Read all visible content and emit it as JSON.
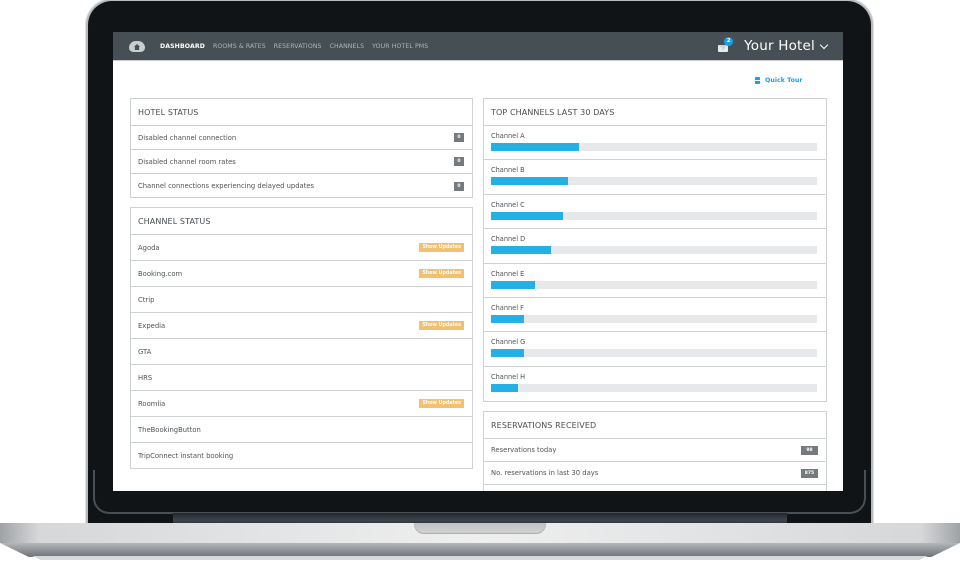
{
  "nav": {
    "items": [
      {
        "label": "DASHBOARD",
        "active": true
      },
      {
        "label": "ROOMS & RATES",
        "active": false
      },
      {
        "label": "RESERVATIONS",
        "active": false
      },
      {
        "label": "CHANNELS",
        "active": false
      },
      {
        "label": "YOUR HOTEL PMS",
        "active": false
      }
    ],
    "mail_count": "2",
    "hotel_name": "Your Hotel"
  },
  "quick_tour": {
    "label": "Quick Tour"
  },
  "hotel_status": {
    "title": "HOTEL STATUS",
    "rows": [
      {
        "label": "Disabled channel connection",
        "count": "0"
      },
      {
        "label": "Disabled channel room rates",
        "count": "0"
      },
      {
        "label": "Channel connections experiencing delayed updates",
        "count": "0"
      }
    ]
  },
  "channel_status": {
    "title": "CHANNEL STATUS",
    "update_label": "Show Updates",
    "rows": [
      {
        "label": "Agoda",
        "has_updates": true
      },
      {
        "label": "Booking.com",
        "has_updates": true
      },
      {
        "label": "Ctrip",
        "has_updates": false
      },
      {
        "label": "Expedia",
        "has_updates": true
      },
      {
        "label": "GTA",
        "has_updates": false
      },
      {
        "label": "HRS",
        "has_updates": false
      },
      {
        "label": "Roomlia",
        "has_updates": true
      },
      {
        "label": "TheBookingButton",
        "has_updates": false
      },
      {
        "label": "TripConnect instant booking",
        "has_updates": false
      }
    ]
  },
  "top_channels": {
    "title": "TOP CHANNELS LAST 30 DAYS",
    "channels": [
      {
        "label": "Channel A",
        "share_percent": 27
      },
      {
        "label": "Channel B",
        "share_percent": 23.5
      },
      {
        "label": "Channel C",
        "share_percent": 22
      },
      {
        "label": "Channel D",
        "share_percent": 18.5
      },
      {
        "label": "Channel E",
        "share_percent": 13.5
      },
      {
        "label": "Channel F",
        "share_percent": 10
      },
      {
        "label": "Channel G",
        "share_percent": 10
      },
      {
        "label": "Channel H",
        "share_percent": 8.3
      }
    ]
  },
  "reservations": {
    "title": "RESERVATIONS RECEIVED",
    "rows": [
      {
        "label": "Reservations today",
        "count": "98"
      },
      {
        "label": "No. reservations in last 30 days",
        "count": "875"
      }
    ]
  },
  "colors": {
    "navbar": "#464f53",
    "accent_blue": "#1a9ee6",
    "bar_fill": "#22b0e6",
    "update_badge": "#f3c06f",
    "count_badge": "#757a7e"
  }
}
